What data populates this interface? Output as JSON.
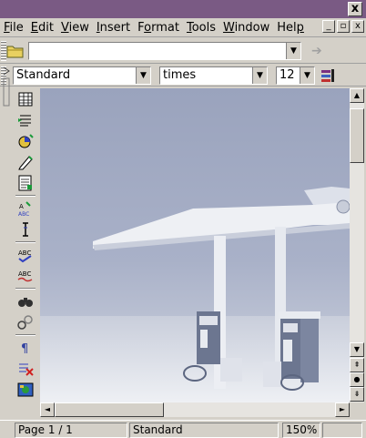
{
  "window": {
    "close_glyph": "x"
  },
  "menubar": {
    "items": [
      {
        "label": "File",
        "hotkey": "F",
        "rest": "ile"
      },
      {
        "label": "Edit",
        "hotkey": "E",
        "rest": "dit"
      },
      {
        "label": "View",
        "hotkey": "V",
        "rest": "iew"
      },
      {
        "label": "Insert",
        "hotkey": "I",
        "rest": "nsert"
      },
      {
        "label": "Format",
        "pre": "F",
        "hotkey": "o",
        "rest": "rmat"
      },
      {
        "label": "Tools",
        "hotkey": "T",
        "rest": "ools"
      },
      {
        "label": "Window",
        "hotkey": "W",
        "rest": "indow"
      },
      {
        "label": "Help",
        "pre": "Hel",
        "hotkey": "p",
        "rest": ""
      }
    ],
    "win_controls": [
      "_",
      "▫",
      "x"
    ]
  },
  "function_bar": {
    "url_value": "",
    "dropdown_glyph": "▼",
    "back_glyph": "➔"
  },
  "object_bar": {
    "paragraph_style": "Standard",
    "font_name": "times",
    "font_size": "12",
    "dropdown_glyph": "▼"
  },
  "left_toolbar": {
    "icons": [
      "table-icon",
      "insert-fields-icon",
      "chart-icon",
      "edit-document-icon",
      "form-icon",
      "autospell-icon",
      "text-cursor-icon",
      "spellcheck-icon",
      "autocorrect-icon",
      "find-icon",
      "hyperlink-icon",
      "formatting-marks-icon",
      "clear-icon",
      "gallery-icon"
    ]
  },
  "scrollbars": {
    "up_glyph": "▲",
    "down_glyph": "▼",
    "left_glyph": "◄",
    "right_glyph": "►",
    "prev_page_glyph": "⇞",
    "next_page_glyph": "⇟",
    "navigator_glyph": "●"
  },
  "status_bar": {
    "page": "Page 1 / 1",
    "style": "Standard",
    "zoom": "150%"
  },
  "colors": {
    "titlebar": "#7a5a84",
    "chrome": "#d4d0c8",
    "document_tint": "#a4adc2"
  }
}
